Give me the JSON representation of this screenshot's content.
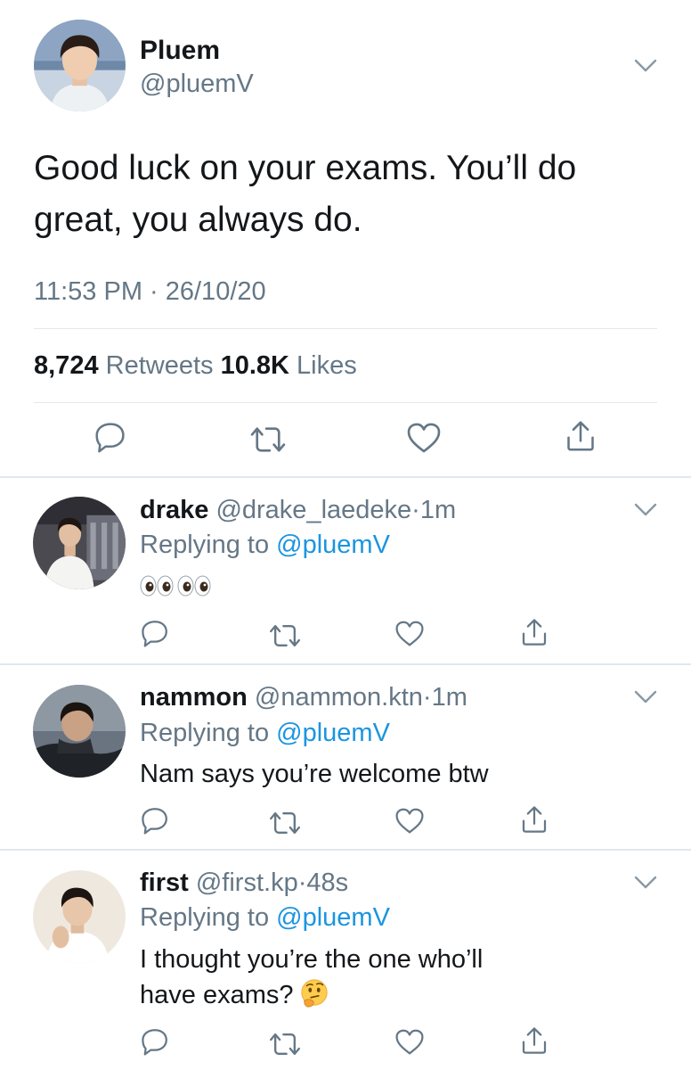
{
  "main_tweet": {
    "name": "Pluem",
    "handle": "@pluemV",
    "text": "Good luck on your exams. You’ll do great, you always do.",
    "timestamp": "11:53 PM · 26/10/20",
    "retweets_count": "8,724",
    "retweets_label": "Retweets",
    "likes_count": "10.8K",
    "likes_label": "Likes",
    "avatar_icon": "profile-photo"
  },
  "icons": {
    "reply": "reply-icon",
    "retweet": "retweet-icon",
    "like": "heart-icon",
    "share": "share-icon",
    "menu": "chevron-down-icon"
  },
  "colors": {
    "text": "#14171a",
    "secondary": "#657786",
    "link": "#1b95e0",
    "divider": "#e1e8ed"
  },
  "replies": [
    {
      "name": "drake",
      "handle": "@drake_laedeke",
      "dot": "·",
      "time": "1m",
      "replying_prefix": "Replying to",
      "replying_to": "@pluemV",
      "text": "",
      "emoji": "eyes-emoji eyes-emoji"
    },
    {
      "name": "nammon",
      "handle": "@nammon.ktn",
      "dot": "·",
      "time": "1m",
      "replying_prefix": "Replying to",
      "replying_to": "@pluemV",
      "text": "Nam says you’re welcome btw"
    },
    {
      "name": "first",
      "handle": "@first.kp",
      "dot": "·",
      "time": "48s",
      "replying_prefix": "Replying to",
      "replying_to": "@pluemV",
      "text_line1": "I thought you’re the one who’ll",
      "text_line2": "have exams?",
      "emoji": "thinking-face-emoji"
    }
  ]
}
